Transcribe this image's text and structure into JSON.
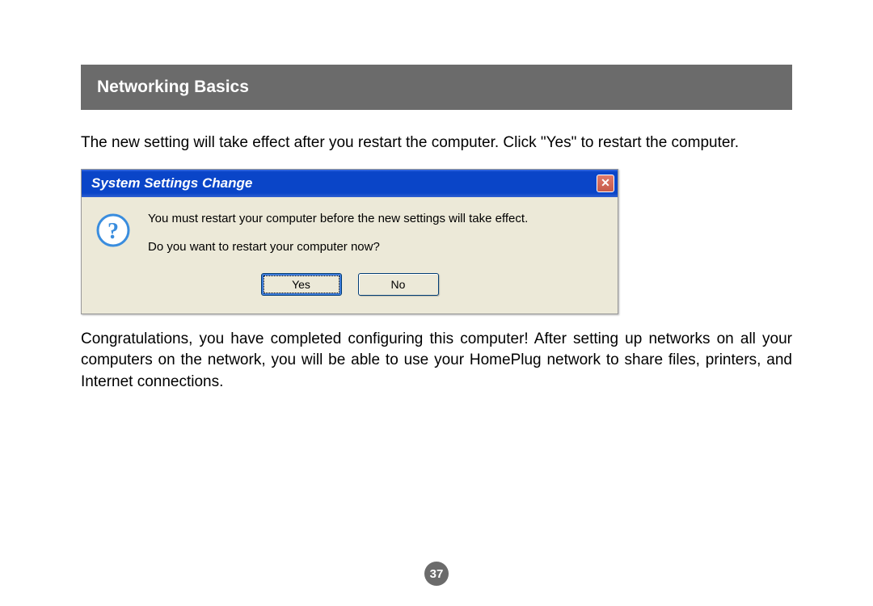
{
  "header": {
    "title": "Networking Basics"
  },
  "text": {
    "intro": "The new setting will take effect after you restart the computer. Click \"Yes\" to restart the computer.",
    "outro": "Congratulations, you have completed configuring this computer! After setting up networks on all your computers on the network, you will be able to use your HomePlug network to share files, printers, and Internet connections."
  },
  "dialog": {
    "title": "System Settings Change",
    "close_symbol": "✕",
    "message1": "You must restart your computer before the new settings will take effect.",
    "message2": "Do you want to restart your computer now?",
    "yes_label": "Yes",
    "no_label": "No"
  },
  "page_number": "37"
}
